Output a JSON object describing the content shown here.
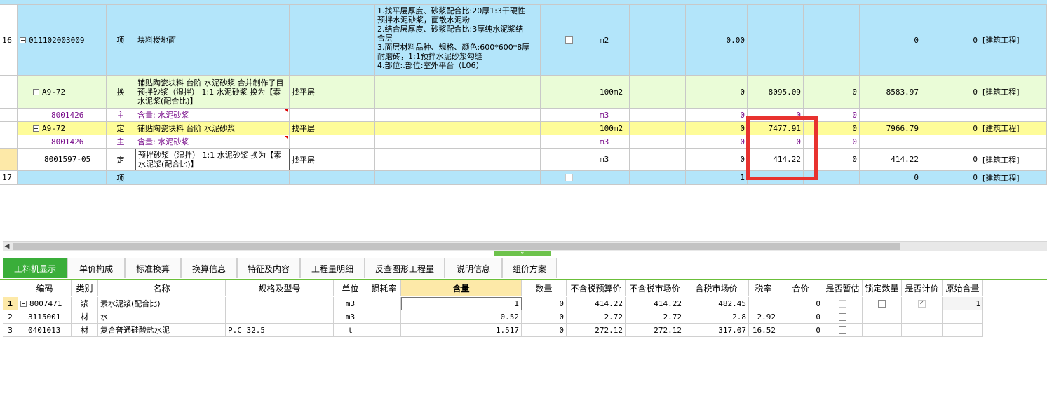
{
  "top_rows": {
    "r16": {
      "num": "16",
      "code": "011102003009",
      "type": "项",
      "name": "块料楼地面",
      "feature_lines": [
        "1.找平层厚度、砂浆配合比:20厚1:3干硬性",
        "预拌水泥砂浆，面散水泥粉",
        "2.结合层厚度、砂浆配合比:3厚纯水泥浆结",
        "合层",
        "3.面层材料品种、规格、颜色:600*600*8厚",
        "耐磨砖，1:1预拌水泥砂浆勾缝",
        "4.部位:.部位:室外平台（L06）"
      ],
      "unit": "m2",
      "qty": "0.00",
      "c1": "0",
      "c2": "0",
      "prof": "[建筑工程]"
    },
    "r_a": {
      "code": "A9-72",
      "type": "换",
      "name": "铺贴陶瓷块料 台阶 水泥砂浆  合并制作子目 预拌砂浆（湿拌） 1:1 水泥砂浆  换为【素水泥浆(配合比)】",
      "remark": "找平层",
      "unit": "100m2",
      "qty": "0",
      "price1": "8095.09",
      "v1": "0",
      "price2": "8583.97",
      "v2": "0",
      "prof": "[建筑工程]"
    },
    "r_b": {
      "code": "8001426",
      "type": "主",
      "name": "含量: 水泥砂浆",
      "unit": "m3",
      "qty": "0",
      "price1": "0",
      "v1": "0"
    },
    "r_c": {
      "code": "A9-72",
      "type": "定",
      "name": "铺贴陶瓷块料 台阶 水泥砂浆",
      "remark": "找平层",
      "unit": "100m2",
      "qty": "0",
      "price1": "7477.91",
      "v1": "0",
      "price2": "7966.79",
      "v2": "0",
      "prof": "[建筑工程]"
    },
    "r_d": {
      "code": "8001426",
      "type": "主",
      "name": "含量: 水泥砂浆",
      "unit": "m3",
      "qty": "0",
      "price1": "0",
      "v1": "0"
    },
    "r_e": {
      "code": "8001597-05",
      "type": "定",
      "name": "预拌砂浆（湿拌） 1:1 水泥砂浆  换为【素水泥浆(配合比)】",
      "remark": "找平层",
      "unit": "m3",
      "qty": "0",
      "price1": "414.22",
      "v1": "0",
      "price2": "414.22",
      "v2": "0",
      "prof": "[建筑工程]"
    },
    "r17": {
      "num": "17",
      "type": "项",
      "qty": "1",
      "c1": "0",
      "c2": "0",
      "prof": "[建筑工程]"
    }
  },
  "tabs": [
    "工料机显示",
    "单价构成",
    "标准换算",
    "换算信息",
    "特征及内容",
    "工程量明细",
    "反查图形工程量",
    "说明信息",
    "组价方案"
  ],
  "grid_headers": [
    "编码",
    "类别",
    "名称",
    "规格及型号",
    "单位",
    "损耗率",
    "含量",
    "数量",
    "不含税预算价",
    "不含税市场价",
    "含税市场价",
    "税率",
    "合价",
    "是否暂估",
    "锁定数量",
    "是否计价",
    "原始含量"
  ],
  "grid_rows": [
    {
      "idx": "1",
      "code": "8007471",
      "cat": "浆",
      "name": "素水泥浆(配合比)",
      "spec": "",
      "unit": "m3",
      "loss": "",
      "content": "1",
      "qty": "0",
      "p1": "414.22",
      "p2": "414.22",
      "p3": "482.45",
      "tax": "",
      "total": "0",
      "orig": "1"
    },
    {
      "idx": "2",
      "code": "3115001",
      "cat": "材",
      "name": "水",
      "spec": "",
      "unit": "m3",
      "loss": "",
      "content": "0.52",
      "qty": "0",
      "p1": "2.72",
      "p2": "2.72",
      "p3": "2.8",
      "tax": "2.92",
      "total": "0",
      "orig": ""
    },
    {
      "idx": "3",
      "code": "0401013",
      "cat": "材",
      "name": "复合普通硅酸盐水泥",
      "spec": "P.C 32.5",
      "unit": "t",
      "loss": "",
      "content": "1.517",
      "qty": "0",
      "p1": "272.12",
      "p2": "272.12",
      "p3": "317.07",
      "tax": "16.52",
      "total": "0",
      "orig": ""
    }
  ],
  "colors": {
    "item_row": "#b3e5fa",
    "sub_row": "#eafcd7",
    "selected_row": "#fefc99",
    "highlight_box": "#e8322f",
    "active_tab": "#3aae3a"
  }
}
